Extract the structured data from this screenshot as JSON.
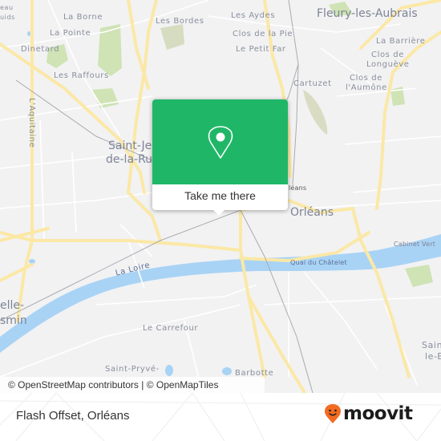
{
  "map": {
    "labels": {
      "eau_luids_1": "eau",
      "eau_luids_2": "uids",
      "la_borne": "La Borne",
      "la_pointe": "La Pointe",
      "dinetard": "Dinetard",
      "les_raffours": "Les Raffours",
      "les_bordes": "Les Bordes",
      "les_aydes": "Les Aydes",
      "clos_de_la_pie": "Clos de la Pie",
      "le_petit_far": "Le Petit Far",
      "fleury": "Fleury-les-Aubrais",
      "la_barriere": "La Barrière",
      "clos_longueve_1": "Clos de",
      "clos_longueve_2": "Longuève",
      "cartuzet": "Cartuzet",
      "clos_aumone_1": "Clos de",
      "clos_aumone_2": "l'Aumône",
      "aquitaine": "L'Aquitaine",
      "saint_jean_1": "Saint-Je",
      "saint_jean_2": "de-la-Ru",
      "orleans_small": "léans",
      "orleans": "Orléans",
      "cabinet_vert": "Cabinet Vert",
      "la_loire": "La Loire",
      "quai_chatelet": "Quai du Châtelet",
      "chapelle_1": "elle-",
      "chapelle_2": "smin",
      "le_carrefour": "Le Carrefour",
      "saint_pryve": "Saint-Pryvé-",
      "barbotte": "Barbotte",
      "saint_jean_braye_1": "Sain",
      "saint_jean_braye_2": "le-B"
    },
    "attribution": "© OpenStreetMap contributors | © OpenMapTiles"
  },
  "popup": {
    "icon": "map-pin-icon",
    "button_label": "Take me there",
    "color": "#1fb767"
  },
  "footer": {
    "place_name": "Flash Offset, Orléans",
    "logo_text": "moovit",
    "logo_icon": "moovit-smiley-pin-icon",
    "logo_color": "#f26b21"
  }
}
